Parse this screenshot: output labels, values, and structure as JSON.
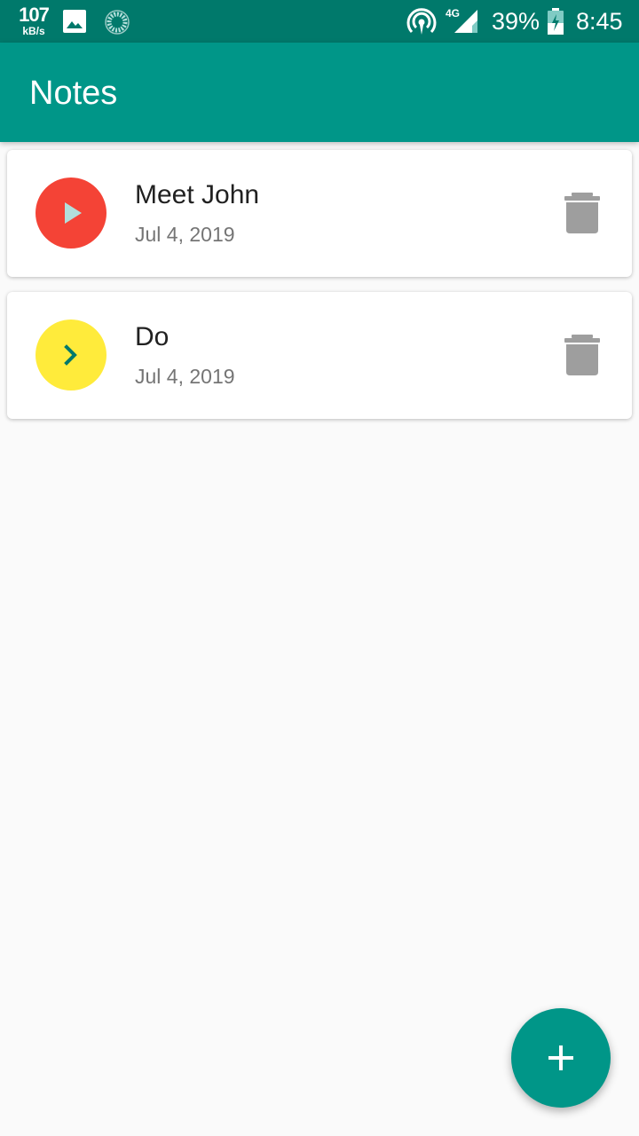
{
  "status_bar": {
    "speed_value": "107",
    "speed_unit": "kB/s",
    "network_type": "4G",
    "battery_percent": "39%",
    "time": "8:45",
    "icons": [
      "image-icon",
      "sync-icon",
      "hotspot-icon",
      "signal-icon",
      "battery-icon"
    ]
  },
  "app_bar": {
    "title": "Notes"
  },
  "notes": [
    {
      "title": "Meet John",
      "date": "Jul 4, 2019",
      "avatar_color": "#f44336",
      "avatar_icon": "play-icon",
      "icon_color": "#b2dfdb",
      "action_icon": "delete-icon"
    },
    {
      "title": "Do",
      "date": "Jul 4, 2019",
      "avatar_color": "#ffeb3b",
      "avatar_icon": "chevron-right-icon",
      "icon_color": "#00796b",
      "action_icon": "delete-icon"
    }
  ],
  "fab": {
    "icon": "add-icon",
    "color": "#009688"
  },
  "colors": {
    "primary": "#009688",
    "primary_dark": "#00796b",
    "background": "#fafafa",
    "delete_icon": "#9e9e9e"
  }
}
